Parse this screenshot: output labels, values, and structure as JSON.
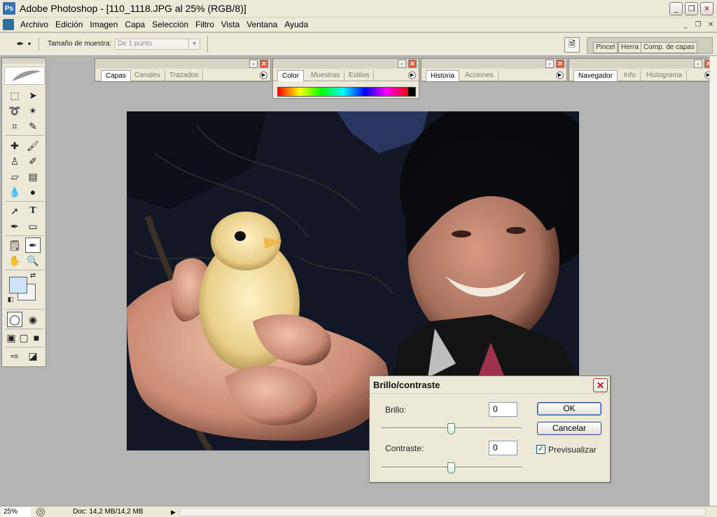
{
  "window": {
    "title": "Adobe Photoshop - [110_1118.JPG al 25% (RGB/8)]",
    "min_icon": "minimize-icon",
    "max_icon": "restore-icon",
    "close_icon": "close-icon"
  },
  "menu": {
    "items": [
      "Archivo",
      "Edición",
      "Imagen",
      "Capa",
      "Selección",
      "Filtro",
      "Vista",
      "Ventana",
      "Ayuda"
    ]
  },
  "options": {
    "sample_label": "Tamaño de muestra:",
    "sample_value": "De 1 punto"
  },
  "palette_well": {
    "tabs": [
      "Pincel",
      "Herra",
      "Comp. de capas"
    ]
  },
  "palettes": {
    "layers": {
      "tabs": [
        "Capas",
        "Canales",
        "Trazados"
      ]
    },
    "color": {
      "tabs": [
        "Color",
        "Muestras",
        "Estilos"
      ]
    },
    "history": {
      "tabs": [
        "Historia",
        "Acciones"
      ]
    },
    "navigator": {
      "tabs": [
        "Navegador",
        "Info",
        "Histograma"
      ]
    }
  },
  "toolbox": {
    "foreground_color": "#cfe3f7",
    "background_color": "#f2f2f2"
  },
  "dialog": {
    "title": "Brillo/contraste",
    "brightness_label": "Brillo:",
    "brightness_value": "0",
    "contrast_label": "Contraste:",
    "contrast_value": "0",
    "ok_label": "OK",
    "cancel_label": "Cancelar",
    "preview_label": "Previsualizar",
    "preview_checked": true
  },
  "status": {
    "zoom": "25%",
    "doc_info": "Doc: 14,2 MB/14,2 MB"
  }
}
